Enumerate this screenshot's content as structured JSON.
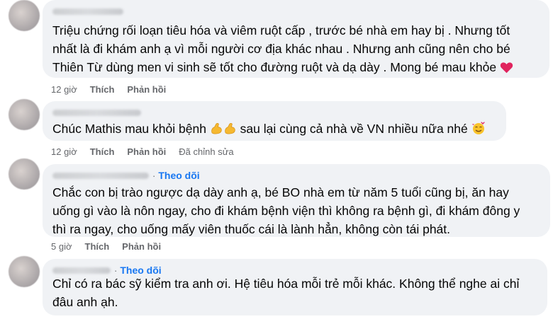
{
  "comments": [
    {
      "text": "Triệu chứng rối loạn tiêu hóa và viêm ruột cấp , trước bé nhà em hay bị . Nhưng tốt\nnhất là đi khám anh ạ vì mỗi người cơ địa khác nhau . Nhưng anh cũng nên cho bé\nThiên Từ dùng men vi sinh sẽ tốt cho đường ruột và dạ dày . Mong bé mau khỏe",
      "time": "12 giờ",
      "like": "Thích",
      "reply": "Phản hồi",
      "emoji_end": "red-heart"
    },
    {
      "text_before": "Chúc Mathis mau khỏi bệnh ",
      "text_after": " sau lại cùng cả nhà về VN nhiều nữa nhé ",
      "time": "12 giờ",
      "like": "Thích",
      "reply": "Phản hồi",
      "edited": "Đã chỉnh sửa",
      "emojis": [
        "flexed-biceps",
        "flexed-biceps",
        "smiling-face-with-hearts"
      ]
    },
    {
      "follow": "Theo dõi",
      "text": "Chắc con bị trào ngược dạ dày anh ạ, bé BO nhà em từ năm 5 tuổi cũng bị, ăn hay\nuống gì vào là nôn ngay, cho đi khám bệnh viện thì không ra bệnh gì, đi khám đông y\nthì ra ngay, cho uống mấy viên thuốc cái là lành hẳn, không còn tái phát.",
      "time": "5 giờ",
      "like": "Thích",
      "reply": "Phản hồi"
    },
    {
      "follow": "Theo dõi",
      "text": "Chỉ có ra bác sỹ kiểm tra anh ơi. Hệ tiêu hóa mỗi trẻ mỗi khác. Không thể nghe ai chỉ\nđâu anh ạh."
    }
  ],
  "colors": {
    "bubble": "#f0f2f5",
    "link": "#1877f2",
    "meta": "#65676b",
    "heart": "#e0245e"
  }
}
